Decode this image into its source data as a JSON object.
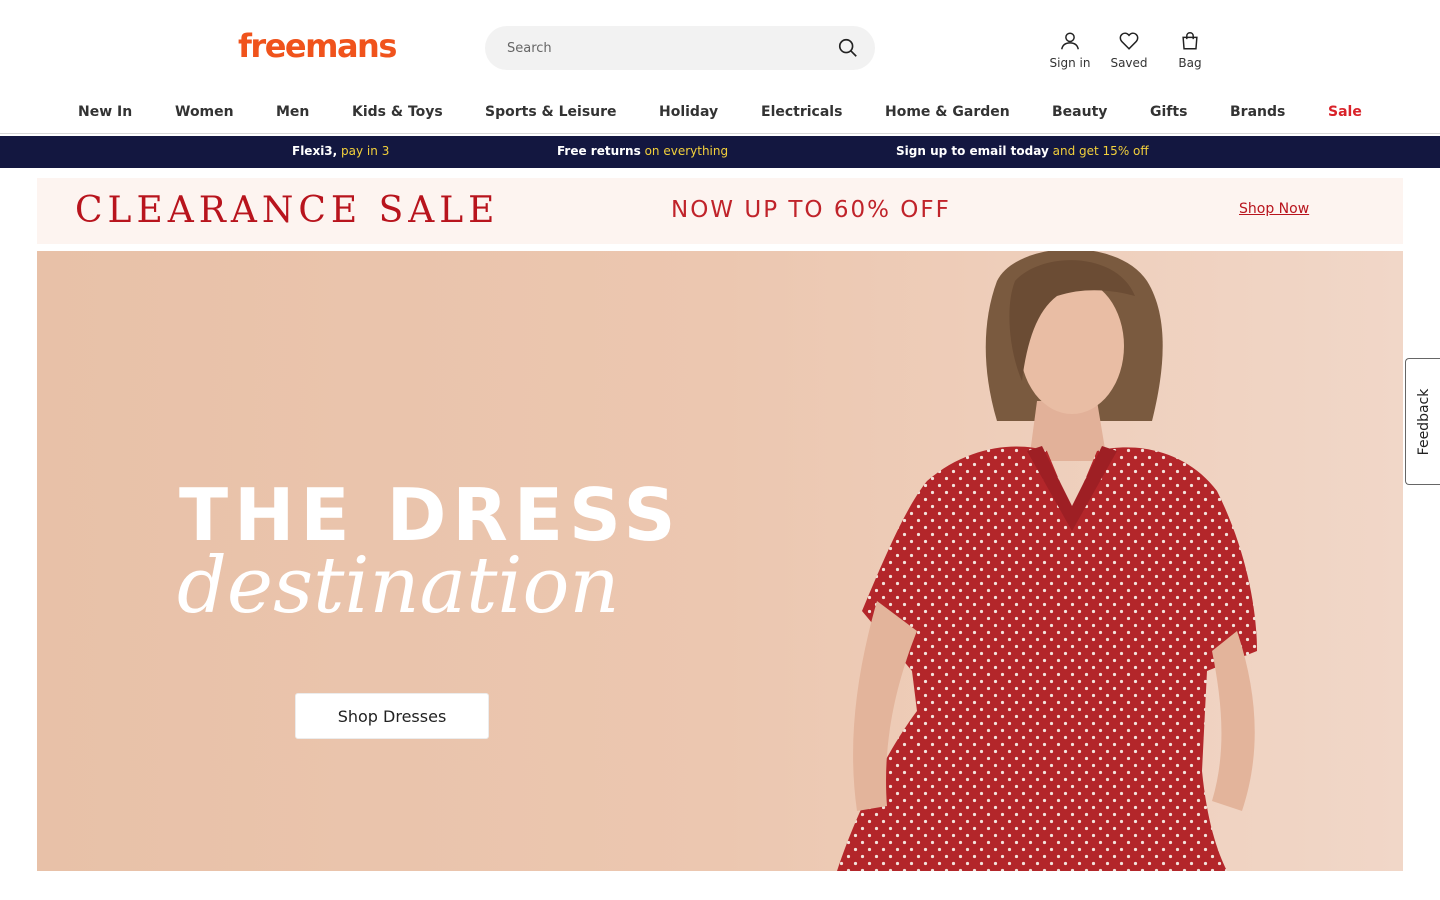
{
  "header": {
    "logo_text": "freemans",
    "search_placeholder": "Search",
    "account": {
      "sign_in_label": "Sign in",
      "saved_label": "Saved",
      "bag_label": "Bag"
    }
  },
  "nav": {
    "items": [
      {
        "label": "New In"
      },
      {
        "label": "Women"
      },
      {
        "label": "Men"
      },
      {
        "label": "Kids & Toys"
      },
      {
        "label": "Sports & Leisure"
      },
      {
        "label": "Holiday"
      },
      {
        "label": "Electricals"
      },
      {
        "label": "Home & Garden"
      },
      {
        "label": "Beauty"
      },
      {
        "label": "Gifts"
      },
      {
        "label": "Brands"
      },
      {
        "label": "Sale"
      }
    ]
  },
  "promo_bar": {
    "items": [
      {
        "bold": "Flexi3,",
        "highlight": "pay in 3"
      },
      {
        "bold": "Free returns",
        "highlight": "on everything"
      },
      {
        "bold": "Sign up to email today",
        "highlight": "and get 15% off"
      }
    ]
  },
  "clearance": {
    "title": "CLEARANCE SALE",
    "offer": "NOW UP TO 60% OFF",
    "link": "Shop Now"
  },
  "hero": {
    "headline": "THE DRESS",
    "subheadline": "destination",
    "button_label": "Shop Dresses"
  },
  "feedback_tab": {
    "label": "Feedback"
  },
  "colors": {
    "brand_orange": "#f0531c",
    "sale_red": "#d9232a",
    "promo_bg": "#131740",
    "promo_highlight": "#f2d03b",
    "clearance_red": "#b8141d"
  },
  "icons": {
    "search": "search-icon",
    "sign_in": "user-icon",
    "saved": "heart-icon",
    "bag": "bag-icon"
  }
}
